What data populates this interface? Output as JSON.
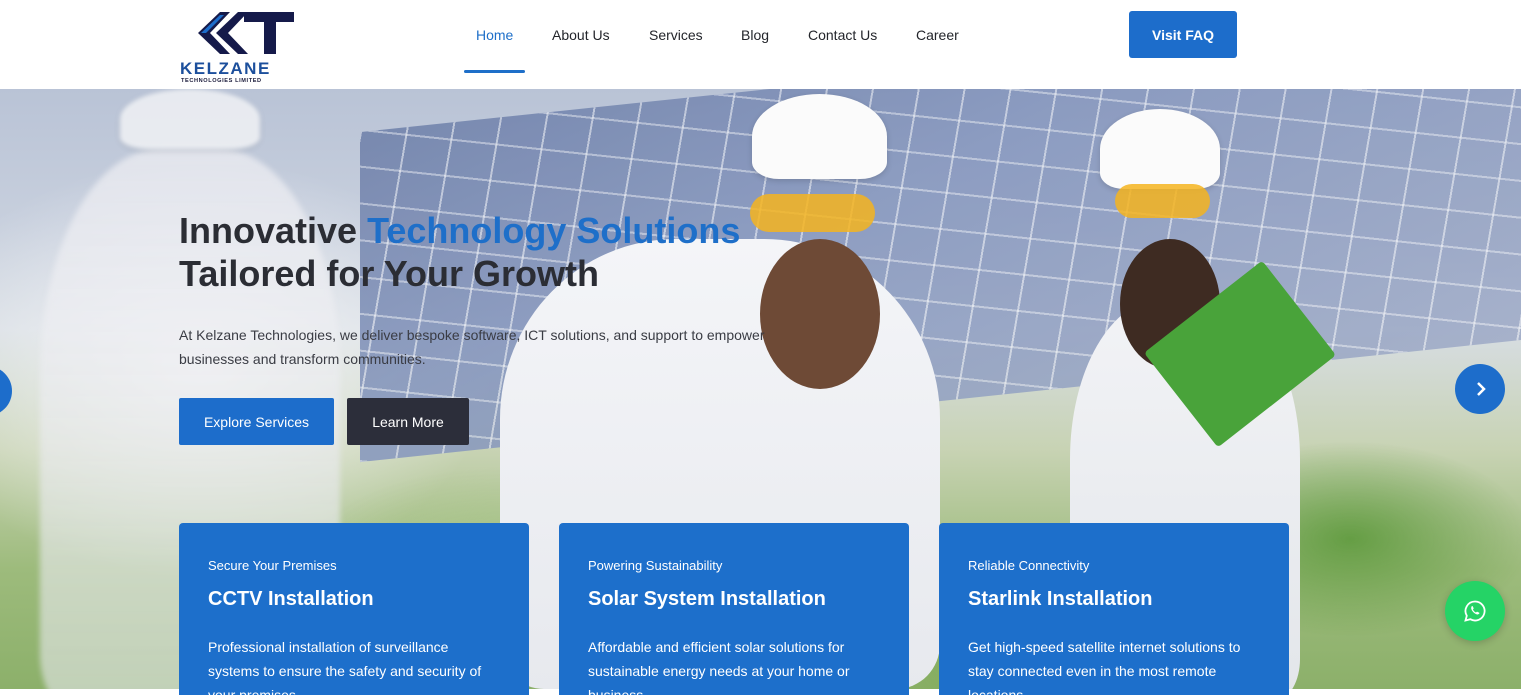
{
  "brand": {
    "name": "KELZANE",
    "tagline": "TECHNOLOGIES LIMITED",
    "primary_color": "#1d6dcb",
    "dark_color": "#2c2e3a"
  },
  "nav": {
    "items": [
      {
        "label": "Home",
        "active": true
      },
      {
        "label": "About Us",
        "active": false
      },
      {
        "label": "Services",
        "active": false
      },
      {
        "label": "Blog",
        "active": false
      },
      {
        "label": "Contact Us",
        "active": false
      },
      {
        "label": "Career",
        "active": false
      }
    ],
    "cta_label": "Visit FAQ"
  },
  "hero": {
    "title_part1": "Innovative ",
    "title_accent": "Technology Solutions",
    "title_line2": "Tailored for Your Growth",
    "description": "At Kelzane Technologies, we deliver bespoke software, ICT solutions, and support to empower businesses and transform communities.",
    "primary_button": "Explore Services",
    "secondary_button": "Learn More"
  },
  "cards": [
    {
      "kicker": "Secure Your Premises",
      "title": "CCTV Installation",
      "text": "Professional installation of surveillance systems to ensure the safety and security of your premises."
    },
    {
      "kicker": "Powering Sustainability",
      "title": "Solar System Installation",
      "text": "Affordable and efficient solar solutions for sustainable energy needs at your home or business."
    },
    {
      "kicker": "Reliable Connectivity",
      "title": "Starlink Installation",
      "text": "Get high-speed satellite internet solutions to stay connected even in the most remote locations."
    }
  ],
  "icons": {
    "carousel_prev": "chevron-left-icon",
    "carousel_next": "chevron-right-icon",
    "chat": "whatsapp-icon"
  }
}
